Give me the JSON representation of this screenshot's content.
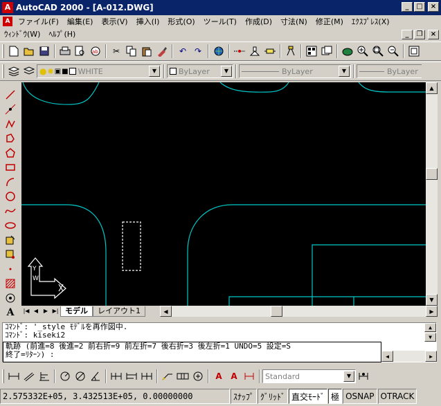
{
  "window": {
    "title": "AutoCAD 2000 - [A-012.DWG]",
    "app_logo": "A",
    "controls": [
      "_",
      "□",
      "×"
    ],
    "doc_controls": [
      "_",
      "❐",
      "×"
    ]
  },
  "menu": {
    "row1": [
      "ファイル(F)",
      "編集(E)",
      "表示(V)",
      "挿入(I)",
      "形式(O)",
      "ツール(T)",
      "作成(D)",
      "寸法(N)",
      "修正(M)",
      "ｴｸｽﾌﾟﾚｽ(X)"
    ],
    "row2": [
      "ｳｨﾝﾄﾞｳ(W)",
      "ﾍﾙﾌﾟ(H)"
    ]
  },
  "toolbar_standard": {
    "icons": [
      "new-icon",
      "open-icon",
      "save-icon",
      "print-icon",
      "preview-icon",
      "spell-icon",
      "cut-icon",
      "copy-icon",
      "paste-icon",
      "matchprop-icon",
      "undo-icon",
      "redo-icon",
      "hyperlink-icon",
      "tracking-icon",
      "ucs-icon",
      "distance-icon",
      "properties-icon",
      "designcenter-icon",
      "named-views-icon",
      "pan-icon",
      "zoom-realtime-icon",
      "zoom-window-icon",
      "zoom-previous-icon",
      "aerial-icon"
    ]
  },
  "toolbar_properties": {
    "layer_value": "WHITE",
    "color_value": "ByLayer",
    "linetype_value": "ByLayer",
    "lineweight_value": "ByLayer"
  },
  "left_toolbar": {
    "icons": [
      "line-icon",
      "construction-line-icon",
      "polyline-icon",
      "polygon-icon",
      "rectangle-icon",
      "arc-icon",
      "circle-icon",
      "spline-icon",
      "ellipse-icon",
      "insert-block-icon",
      "make-block-icon",
      "point-icon",
      "hatch-icon",
      "region-icon",
      "text-icon"
    ]
  },
  "tabs": {
    "model": "モデル",
    "layout": "レイアウト1"
  },
  "ucs": {
    "y_label": "Y",
    "w_label": "W"
  },
  "command": {
    "line1": "ｺﾏﾝﾄﾞ: '_style ﾓﾃﾞﾙを再作図中.",
    "line2": "ｺﾏﾝﾄﾞ: kiseki2",
    "line3": "軌跡 (前進=8 後進=2 前右折=9 前左折=7 後右折=3 後左折=1 UNDO=5 設定=S",
    "line4": "終了=ﾘﾀｰﾝ) :"
  },
  "toolbar_dimension": {
    "text_style": "Standard"
  },
  "status": {
    "coords": "2.575332E+05, 3.432513E+05, 0.00000000",
    "snap": "ｽﾅｯﾌﾟ",
    "grid": "ｸﾞﾘｯﾄﾞ",
    "ortho": "直交ﾓｰﾄﾞ",
    "polar": "極",
    "osnap": "OSNAP",
    "otrack": "OTRACK"
  },
  "colors": {
    "drawing_bg": "#000000",
    "drawing_line": "#00c8c8",
    "title_bar": "#0a246a"
  }
}
